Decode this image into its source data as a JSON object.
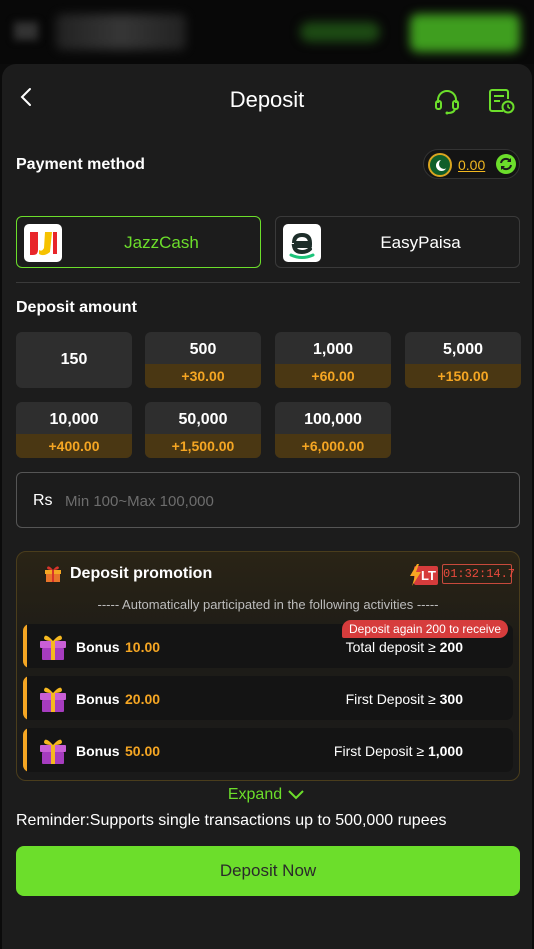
{
  "header": {
    "title": "Deposit"
  },
  "payment": {
    "label": "Payment method",
    "balance": "0.00",
    "methods": [
      {
        "name": "JazzCash",
        "selected": true
      },
      {
        "name": "EasyPaisa",
        "selected": false
      }
    ]
  },
  "deposit_amount": {
    "label": "Deposit amount",
    "options": [
      {
        "value": "150",
        "bonus": ""
      },
      {
        "value": "500",
        "bonus": "+30.00"
      },
      {
        "value": "1,000",
        "bonus": "+60.00"
      },
      {
        "value": "5,000",
        "bonus": "+150.00"
      },
      {
        "value": "10,000",
        "bonus": "+400.00"
      },
      {
        "value": "50,000",
        "bonus": "+1,500.00"
      },
      {
        "value": "100,000",
        "bonus": "+6,000.00"
      }
    ],
    "currency": "Rs",
    "placeholder": "Min 100~Max 100,000"
  },
  "promotion": {
    "title": "Deposit promotion",
    "badge": "LT",
    "timer": "01:32:14.7",
    "subtitle": "----- Automatically participated in the following activities -----",
    "tag": "Deposit again 200 to receive",
    "bonuses": [
      {
        "label": "Bonus",
        "amount": "10.00",
        "condition": "Total deposit ≥",
        "threshold": "200"
      },
      {
        "label": "Bonus",
        "amount": "20.00",
        "condition": "First Deposit ≥",
        "threshold": "300"
      },
      {
        "label": "Bonus",
        "amount": "50.00",
        "condition": "First Deposit ≥",
        "threshold": "1,000"
      }
    ],
    "expand_label": "Expand"
  },
  "reminder": "Reminder:Supports single transactions up to 500,000 rupees",
  "deposit_button": "Deposit Now",
  "colors": {
    "accent": "#6cde2b",
    "bonus": "#f5a623",
    "timer": "#e84a3c",
    "panel": "#1c1c1c"
  },
  "icons": [
    "back-icon",
    "support-headset-icon",
    "record-icon",
    "flag-icon",
    "refresh-icon",
    "gift-icon",
    "lightning-icon",
    "chevron-down-icon"
  ]
}
